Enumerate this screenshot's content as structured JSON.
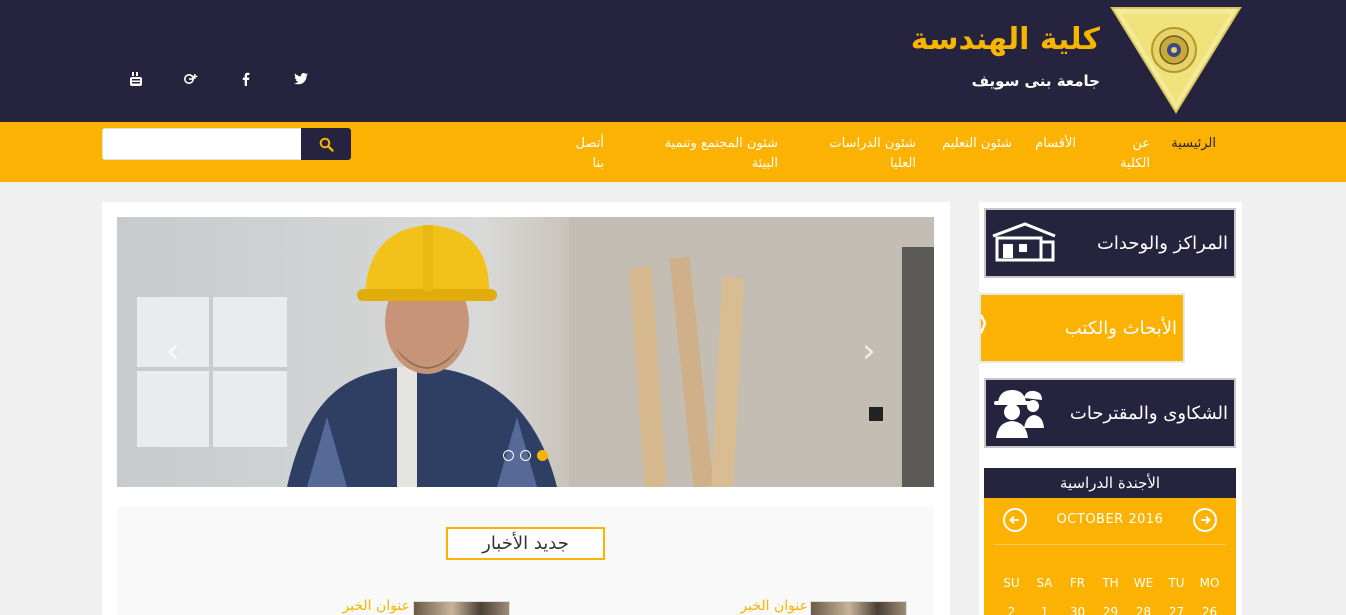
{
  "header": {
    "college_name": "كلية الهندسة",
    "university_name": "جامعة بنى سويف",
    "socials": [
      {
        "icon": "youtube-icon"
      },
      {
        "icon": "google-plus-icon"
      },
      {
        "icon": "facebook-icon"
      },
      {
        "icon": "twitter-icon"
      }
    ]
  },
  "nav": {
    "items": [
      {
        "label": "الرئيسية"
      },
      {
        "label": "عن الكلية"
      },
      {
        "label": "الأقسام"
      },
      {
        "label": "شئون التعليم"
      },
      {
        "label": "شئون الدراسات العليا"
      },
      {
        "label": "شئون المجتمع وتنمية البيئة"
      },
      {
        "label": "أتصل بنا"
      }
    ],
    "search_placeholder": ""
  },
  "slider": {
    "prev": "‹",
    "next": "›",
    "dots": 3,
    "active_dot": 3
  },
  "news": {
    "heading": "جديد الأخبار",
    "items": [
      {
        "title": "عنوان الخبر"
      },
      {
        "title": "عنوان الخبر"
      }
    ]
  },
  "sidebar": {
    "tiles": [
      {
        "label": "المراكز والوحدات",
        "icon": "building-icon"
      },
      {
        "label": "الأبحاث والكتب",
        "icon": "book-icon"
      },
      {
        "label": "الشكاوى والمقترحات",
        "icon": "workers-icon"
      }
    ]
  },
  "calendar": {
    "title": "الأجندة الدراسية",
    "month": "OCTOBER 2016",
    "days_of_week": [
      "SU",
      "SA",
      "FR",
      "TH",
      "WE",
      "TU",
      "MO"
    ],
    "first_row": [
      "2",
      "1",
      "30",
      "29",
      "28",
      "27",
      "26"
    ]
  },
  "colors": {
    "dark": "#25233d",
    "accent": "#fbb203"
  }
}
